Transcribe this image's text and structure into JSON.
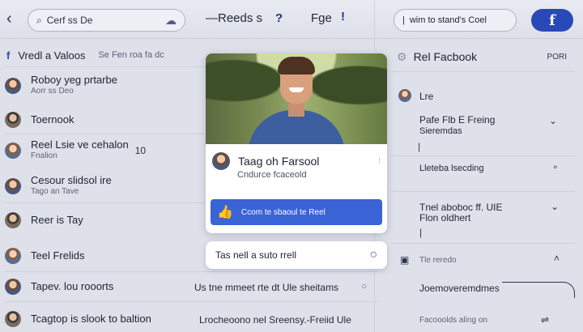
{
  "topbar": {
    "back_icon": "chevron-left-icon",
    "search_text": "Cerf ss De",
    "nav_reels": "—Reeds s",
    "nav_help": "?",
    "nav_page": "Fge",
    "nav_info": "!",
    "right_search": "wim to stand's Coel",
    "brand": "f"
  },
  "left": {
    "header": "Vredl a Valoos",
    "header_sub": "Se Fen roa fa dc",
    "items": [
      {
        "title": "Roboy yeg prtarbe",
        "sub": "Aorr ss Deo",
        "extra": ""
      },
      {
        "title": "Toernook",
        "sub": "",
        "extra": ""
      },
      {
        "title": "Reel Lsie ve cehalon",
        "sub": "Fnalion",
        "extra": "10"
      },
      {
        "title": "Cesour slidsol ire",
        "sub": "Tago an Tave",
        "extra": ""
      },
      {
        "title": "Reer is Tay",
        "sub": "",
        "extra": ""
      },
      {
        "title": "Teel Frelids",
        "sub": "",
        "extra": ""
      },
      {
        "title": "Tapev. lou rooorts",
        "sub": "",
        "extra": ""
      },
      {
        "title": "Tcagtop is slook to baltion",
        "sub": "",
        "extra": ""
      }
    ]
  },
  "center": {
    "card_name": "Taag oh Farsool",
    "card_sub": "Cndurce fcaceold",
    "card_button": "Ccom te sbaoul te Reel",
    "search_text": "Tas nell a suto rrell",
    "row1": "Us tne mmeet rte dt Ule sheitams",
    "row2": "Lrocheoono nel Sreensy.-Freiid Ule"
  },
  "right": {
    "header": "Rel Facbook",
    "header_action": "PORI",
    "lines": [
      {
        "text": "Lre"
      },
      {
        "text": "Pafe Flb E Freing"
      },
      {
        "text": "Sieremdas"
      },
      {
        "text": "Lleteba lsecding"
      },
      {
        "text": "Tnel aboboc ff. UIE"
      },
      {
        "text": "Flon oldhert"
      },
      {
        "text": "Tle reredo"
      },
      {
        "text": "Joemoveremdmes"
      },
      {
        "text": "Facooolds aling on"
      }
    ]
  }
}
